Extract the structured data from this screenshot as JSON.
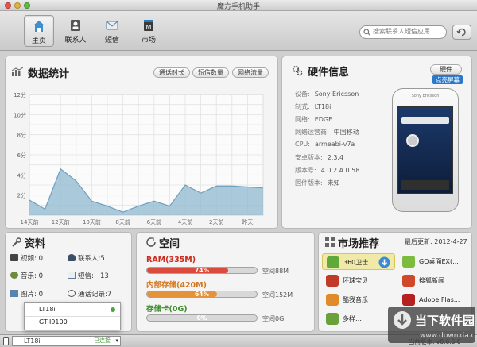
{
  "window": {
    "title": "魔方手机助手"
  },
  "toolbar": {
    "nav": [
      {
        "label": "主页",
        "icon": "home-icon",
        "active": true
      },
      {
        "label": "联系人",
        "icon": "contacts-icon",
        "active": false
      },
      {
        "label": "短信",
        "icon": "message-icon",
        "active": false
      },
      {
        "label": "市场",
        "icon": "market-icon",
        "active": false
      }
    ],
    "search_placeholder": "搜索联系人短信应用..."
  },
  "stats": {
    "title": "数据统计",
    "tabs": [
      "通话时长",
      "短信数量",
      "网络流量"
    ]
  },
  "chart_data": {
    "type": "area",
    "title": "",
    "x": [
      "14天前",
      "",
      "12天前",
      "",
      "10天前",
      "",
      "8天前",
      "",
      "6天前",
      "",
      "4天前",
      "",
      "2天前",
      "",
      "昨天",
      ""
    ],
    "y_ticks": [
      "2分",
      "4分",
      "6分",
      "8分",
      "10分",
      "12分"
    ],
    "ylim": [
      0,
      12
    ],
    "values": [
      1.5,
      0.6,
      4.6,
      3.4,
      1.4,
      0.9,
      0.3,
      0.9,
      1.4,
      0.9,
      3.0,
      2.2,
      2.9,
      2.9,
      2.8,
      2.7
    ],
    "color": "#8fb9d2",
    "grid": true
  },
  "hardware": {
    "title": "硬件信息",
    "button": "硬件",
    "tooltip": "点亮屏幕",
    "rows": [
      {
        "label": "设备:",
        "value": "Sony Ericsson"
      },
      {
        "label": "制式:",
        "value": "LT18i"
      },
      {
        "label": "网络:",
        "value": "EDGE"
      },
      {
        "label": "网络运营商:",
        "value": "中国移动"
      },
      {
        "label": "CPU:",
        "value": "armeabi-v7a"
      },
      {
        "label": "安卓版本:",
        "value": "2.3.4"
      },
      {
        "label": "版本号:",
        "value": "4.0.2.A.0.58"
      },
      {
        "label": "固件版本:",
        "value": "未知"
      }
    ],
    "phone_brand": "Sony Ericsson"
  },
  "data": {
    "title": "资料",
    "items": [
      {
        "label": "视频:",
        "value": "0",
        "icon": "video-icon"
      },
      {
        "label": "联系人:",
        "value": "5",
        "icon": "contact-person-icon"
      },
      {
        "label": "音乐:",
        "value": "0",
        "icon": "music-icon"
      },
      {
        "label": "短信:",
        "value": "13",
        "icon": "sms-icon"
      },
      {
        "label": "图片:",
        "value": "0",
        "icon": "picture-icon"
      },
      {
        "label": "通话记录:",
        "value": "7",
        "icon": "call-log-icon"
      }
    ],
    "device_list": [
      "LT18i",
      "GT-I9100"
    ]
  },
  "space": {
    "title": "空间",
    "items": [
      {
        "label": "RAM(335M)",
        "percent": 74,
        "percent_text": "74%",
        "free": "空间88M",
        "color": "#d94b3c",
        "label_color": "#cc2a1e"
      },
      {
        "label": "内部存储(420M)",
        "percent": 64,
        "percent_text": "64%",
        "free": "空间152M",
        "color": "#e4933b",
        "label_color": "#d5781e"
      },
      {
        "label": "存储卡(0G)",
        "percent": 0,
        "percent_text": "0%",
        "free": "空间0G",
        "color": "#58a845",
        "label_color": "#3f8c2c"
      }
    ]
  },
  "market": {
    "title": "市场推荐",
    "updated": "最后更新: 2012-4-27",
    "apps": [
      {
        "name": "360卫士",
        "color": "#5fa83a",
        "selected": true
      },
      {
        "name": "GO桌面EX(...",
        "color": "#7dbb3c",
        "selected": false
      },
      {
        "name": "环球宝贝",
        "color": "#c03a2a",
        "selected": false
      },
      {
        "name": "搜狐新闻",
        "color": "#d04a2a",
        "selected": false
      },
      {
        "name": "酷我音乐",
        "color": "#e08a2a",
        "selected": false
      },
      {
        "name": "Adobe Flas...",
        "color": "#b52020",
        "selected": false
      },
      {
        "name": "多样…",
        "color": "#6aa13a",
        "selected": false
      }
    ]
  },
  "statusbar": {
    "device": "LT18i",
    "device_status": "已连接",
    "version": "当前版本: v0.6.6.0"
  },
  "watermark": {
    "text": "当下软件园",
    "url": "www.downxia.com"
  }
}
